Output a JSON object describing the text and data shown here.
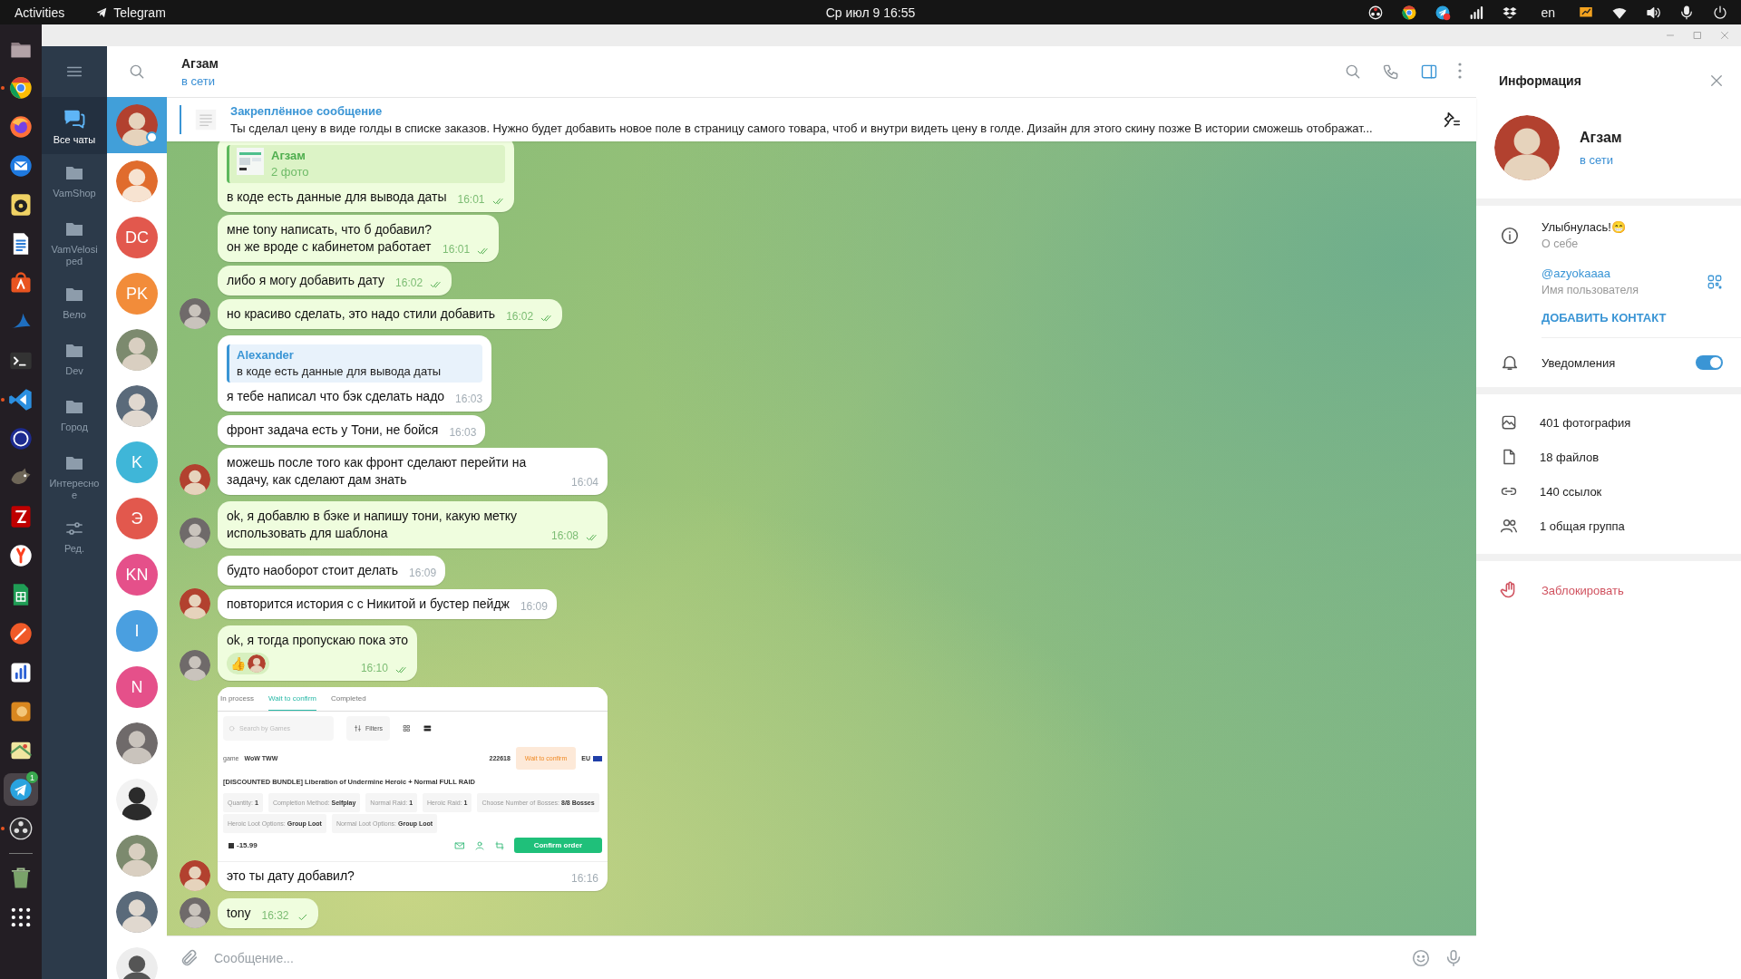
{
  "top_bar": {
    "activities": "Activities",
    "app_name": "Telegram",
    "clock": "Ср июл 9  16:55",
    "keyboard_layout": "en"
  },
  "dock": [
    {
      "kind": "files",
      "running": false,
      "focused": false
    },
    {
      "kind": "chrome",
      "running": true,
      "focused": false
    },
    {
      "kind": "firefox",
      "running": false,
      "focused": false
    },
    {
      "kind": "thunderbird",
      "running": false,
      "focused": false
    },
    {
      "kind": "rhythmbox",
      "running": false,
      "focused": false
    },
    {
      "kind": "writer",
      "running": false,
      "focused": false
    },
    {
      "kind": "appcenter",
      "running": false,
      "focused": false
    },
    {
      "kind": "wireshark",
      "running": false,
      "focused": false
    },
    {
      "kind": "terminal",
      "running": false,
      "focused": false
    },
    {
      "kind": "vscode",
      "running": true,
      "focused": false
    },
    {
      "kind": "mc",
      "running": false,
      "focused": false
    },
    {
      "kind": "gimp",
      "running": false,
      "focused": false
    },
    {
      "kind": "filezilla",
      "running": false,
      "focused": false
    },
    {
      "kind": "yandex",
      "running": false,
      "focused": false
    },
    {
      "kind": "sheets",
      "running": false,
      "focused": false
    },
    {
      "kind": "pen",
      "running": false,
      "focused": false
    },
    {
      "kind": "chart",
      "running": false,
      "focused": false
    },
    {
      "kind": "blender",
      "running": false,
      "focused": false
    },
    {
      "kind": "maps",
      "running": false,
      "focused": false
    },
    {
      "kind": "telegram",
      "running": false,
      "focused": true,
      "badge": "1"
    },
    {
      "kind": "obs",
      "running": true,
      "focused": false
    },
    {
      "kind": "trash",
      "running": false,
      "focused": false
    },
    {
      "kind": "apps",
      "running": false,
      "focused": false
    }
  ],
  "folders": [
    {
      "kind": "all_chats",
      "label": "Все чаты",
      "selected": true
    },
    {
      "kind": "folder",
      "label": "VamShop",
      "selected": false
    },
    {
      "kind": "folder",
      "label": "VamVelosiped",
      "selected": false
    },
    {
      "kind": "folder",
      "label": "Вело",
      "selected": false
    },
    {
      "kind": "folder",
      "label": "Dev",
      "selected": false
    },
    {
      "kind": "folder",
      "label": "Город",
      "selected": false
    },
    {
      "kind": "folder",
      "label": "Интересное",
      "selected": false
    },
    {
      "kind": "edit",
      "label": "Ред.",
      "selected": false
    }
  ],
  "chat_list": [
    {
      "kind": "picture",
      "selected": true,
      "online": true
    },
    {
      "kind": "picture",
      "selected": false,
      "online": false
    },
    {
      "kind": "initials",
      "initials": "DC",
      "color": "#e2584d",
      "selected": false,
      "online": false
    },
    {
      "kind": "initials",
      "initials": "PK",
      "color": "#f28c3a",
      "selected": false,
      "online": false
    },
    {
      "kind": "picture",
      "selected": false,
      "online": false
    },
    {
      "kind": "picture",
      "selected": false,
      "online": false
    },
    {
      "kind": "initials",
      "initials": "K",
      "color": "#3fb6d8",
      "selected": false,
      "online": false
    },
    {
      "kind": "initials",
      "initials": "Э",
      "color": "#e2584d",
      "selected": false,
      "online": false
    },
    {
      "kind": "initials",
      "initials": "KN",
      "color": "#e5508a",
      "selected": false,
      "online": false
    },
    {
      "kind": "initials",
      "initials": "I",
      "color": "#4a9fe0",
      "selected": false,
      "online": false
    },
    {
      "kind": "initials",
      "initials": "N",
      "color": "#e5508a",
      "selected": false,
      "online": false
    },
    {
      "kind": "picture",
      "selected": false,
      "online": false
    },
    {
      "kind": "picture",
      "selected": false,
      "online": false
    },
    {
      "kind": "picture",
      "selected": false,
      "online": false
    },
    {
      "kind": "picture",
      "selected": false,
      "online": false
    },
    {
      "kind": "picture",
      "selected": false,
      "online": false
    }
  ],
  "chat_header": {
    "name": "Агзам",
    "status": "в сети",
    "panel_toggle_active": true
  },
  "pinned": {
    "title": "Закреплённое сообщение",
    "text": "Ты сделал цену в виде голды в списке заказов. Нужно будет добавить новое поле в страницу самого товара, чтоб и внутри видеть цену в голде. Дизайн для этого скину позже В истории сможешь отображат..."
  },
  "messages": [
    {
      "kind": "own",
      "reply": {
        "kind": "photo",
        "name": "Агзам",
        "text": "2 фото"
      },
      "text": "в коде есть данные для вывода даты",
      "time": "16:01",
      "read": true,
      "avatar": false
    },
    {
      "kind": "own",
      "text": "мне tony написать, что б добавил?\nон же вроде с кабинетом работает",
      "time": "16:01",
      "read": true,
      "avatar": false
    },
    {
      "kind": "own",
      "text": "либо я могу добавить дату",
      "time": "16:02",
      "read": true,
      "avatar": false
    },
    {
      "kind": "own",
      "text": "но красиво сделать, это надо стили добавить",
      "time": "16:02",
      "read": true,
      "avatar": true
    },
    {
      "kind": "incoming",
      "reply": {
        "kind": "text",
        "name": "Alexander",
        "text": "в коде есть данные для вывода даты"
      },
      "text": "я тебе написал что бэк сделать надо",
      "time": "16:03",
      "avatar": false
    },
    {
      "kind": "incoming",
      "text": "фронт задача есть у Тони, не бойся",
      "time": "16:03",
      "avatar": false
    },
    {
      "kind": "incoming",
      "text": "можешь после того как фронт сделают перейти на задачу, как сделают дам знать",
      "time": "16:04",
      "avatar": true
    },
    {
      "kind": "own",
      "text": "ok, я добавлю в бэке и напишу тони, какую метку использовать для шаблона",
      "time": "16:08",
      "read": true,
      "avatar": true
    },
    {
      "kind": "incoming",
      "text": "будто наоборот стоит делать",
      "time": "16:09",
      "avatar": false
    },
    {
      "kind": "incoming",
      "text": "повторится история с с Никитой и бустер пейдж",
      "time": "16:09",
      "avatar": true
    },
    {
      "kind": "own",
      "text": "ok, я тогда пропускаю пока это",
      "reaction": "👍",
      "time": "16:10",
      "read": true,
      "avatar": true
    },
    {
      "kind": "incoming",
      "attachment": {
        "kind": "screenshot",
        "tabs": [
          {
            "label": "In process",
            "selected": false
          },
          {
            "label": "Wait to confirm",
            "selected": true
          },
          {
            "label": "Completed",
            "selected": false
          }
        ],
        "search_placeholder": "Search by Games",
        "filters": "Filters",
        "game_label": "game",
        "game": "WoW TWW",
        "order_id": "222618",
        "status": "Wait to confirm",
        "region": "EU",
        "title": "[DISCOUNTED BUNDLE] Liberation of Undermine Heroic + Normal FULL RAID",
        "options": [
          {
            "label": "Quantity:",
            "value": "1"
          },
          {
            "label": "Completion Method:",
            "value": "Selfplay"
          },
          {
            "label": "Normal Raid:",
            "value": "1"
          },
          {
            "label": "Heroic Raid:",
            "value": "1"
          },
          {
            "label": "Choose Number of Bosses:",
            "value": "8/8 Bosses"
          },
          {
            "label": "Heroic Loot Options:",
            "value": "Group Loot"
          },
          {
            "label": "Normal Loot Options:",
            "value": "Group Loot"
          }
        ],
        "price": "-15.99",
        "button": "Confirm order"
      },
      "text": "это ты дату добавил?",
      "time": "16:16",
      "avatar": true
    },
    {
      "kind": "own",
      "text": "tony",
      "time": "16:32",
      "read": false,
      "avatar": true
    }
  ],
  "composer": {
    "placeholder": "Сообщение..."
  },
  "info_panel": {
    "title": "Информация",
    "name": "Агзам",
    "status": "в сети",
    "bio": "Улыбнулась!😁",
    "bio_label": "О себе",
    "username": "@azyokaaaa",
    "username_label": "Имя пользователя",
    "add_contact": "ДОБАВИТЬ КОНТАКТ",
    "notifications": {
      "label": "Уведомления",
      "on": true
    },
    "media": [
      {
        "kind": "photos",
        "label": "401 фотография"
      },
      {
        "kind": "files",
        "label": "18 файлов"
      },
      {
        "kind": "links",
        "label": "140 ссылок"
      },
      {
        "kind": "groups",
        "label": "1 общая группа"
      }
    ],
    "block": "Заблокировать"
  }
}
